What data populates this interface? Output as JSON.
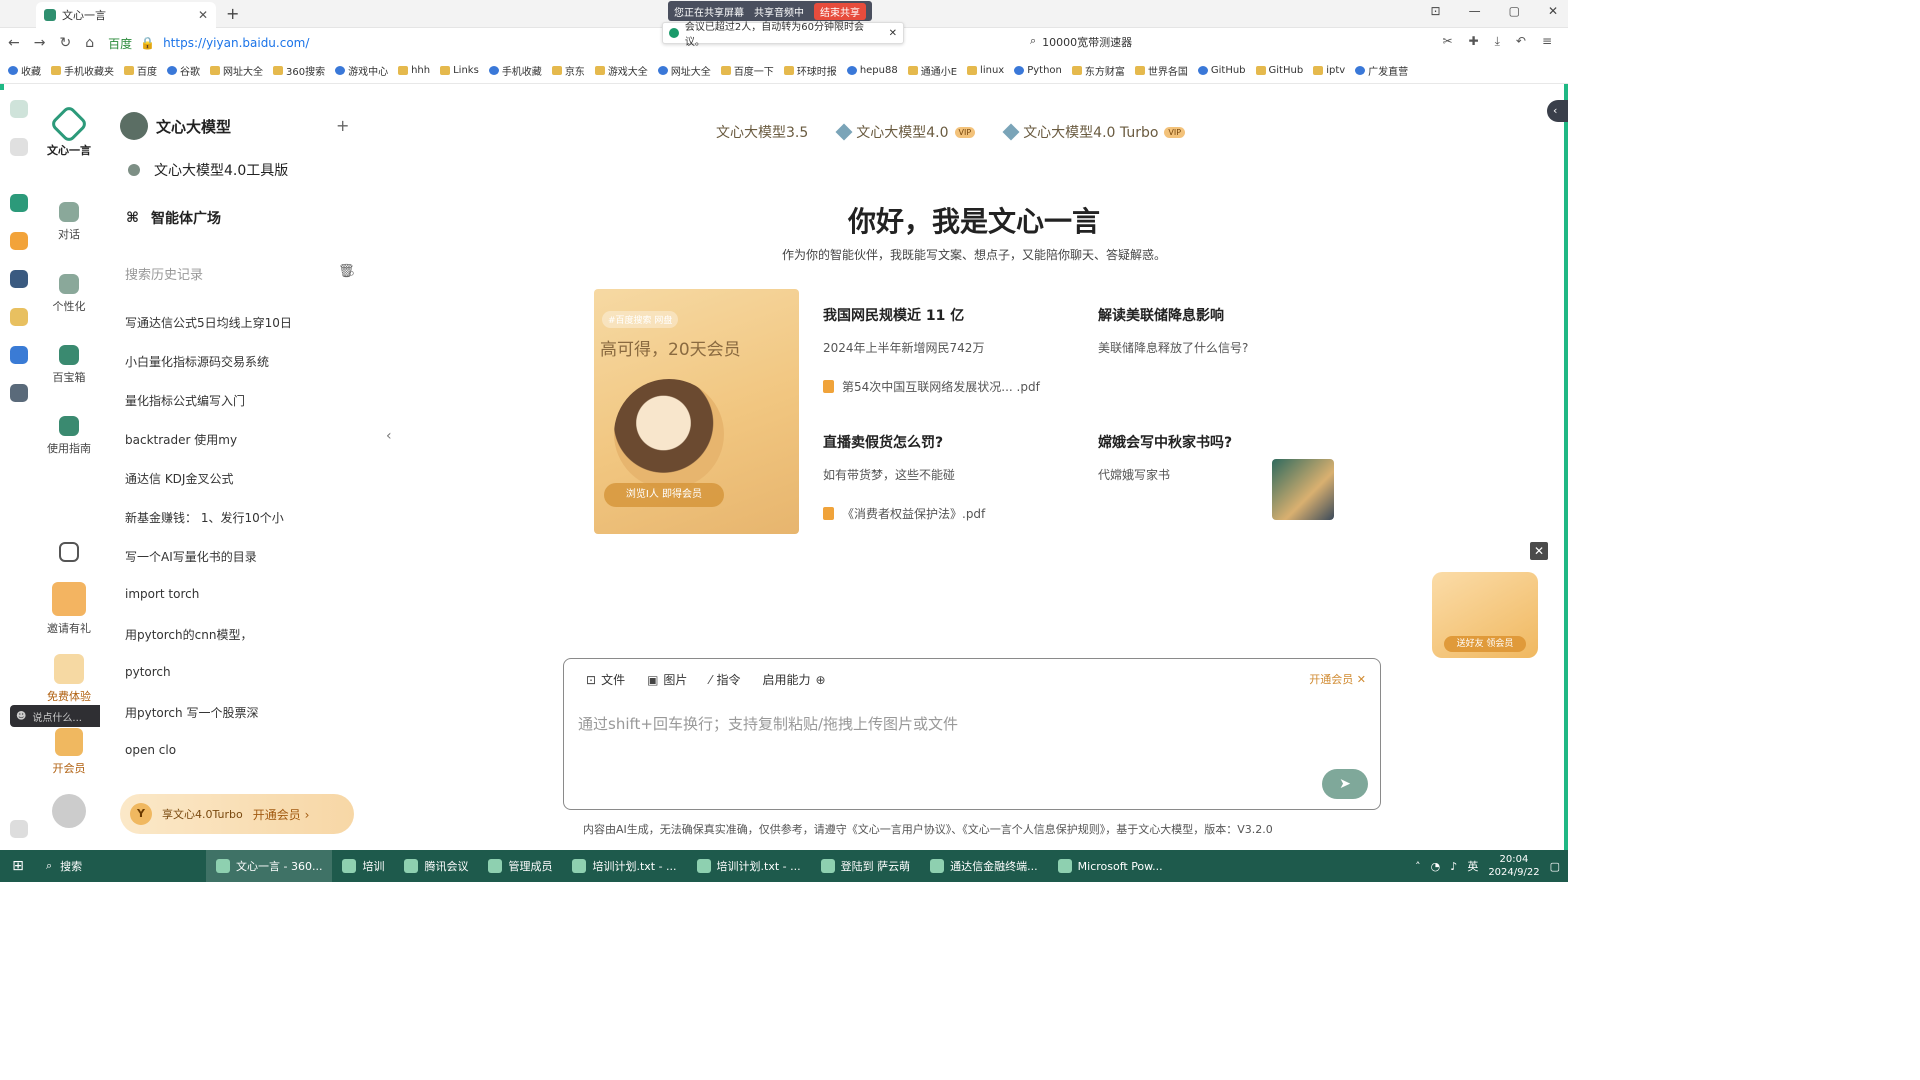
{
  "browser": {
    "tab_title": "文心一言",
    "url": "https://yiyan.baidu.com/",
    "url_site": "百度",
    "share_status": "您正在共享屏幕",
    "share_audio": "共享音频中",
    "end_share": "结束共享",
    "meeting_note": "会议已超过2人，自动转为60分钟限时会议。",
    "search_text": "10000宽带测速器"
  },
  "bookmarks": [
    "收藏",
    "手机收藏夹",
    "百度",
    "谷歌",
    "网址大全",
    "360搜索",
    "游戏中心",
    "hhh",
    "Links",
    "手机收藏",
    "京东",
    "游戏大全",
    "网址大全",
    "百度一下",
    "环球时报",
    "hepu88",
    "通通小E",
    "linux",
    "Python",
    "东方财富",
    "世界各国",
    "GitHub",
    "GitHub",
    "iptv",
    "广发直营"
  ],
  "nav": {
    "logo_label": "文心一言",
    "items": [
      {
        "label": "对话"
      },
      {
        "label": "个性化"
      },
      {
        "label": "百宝箱"
      },
      {
        "label": "使用指南"
      }
    ],
    "bottom": [
      {
        "label": "邀请有礼"
      },
      {
        "label": "免费体验"
      },
      {
        "label": "开会员"
      }
    ],
    "float_chip": "说点什么..."
  },
  "sidebar": {
    "title": "文心大模型",
    "tool_version": "文心大模型4.0工具版",
    "agent_plaza": "智能体广场",
    "search_placeholder": "搜索历史记录",
    "history": [
      "写通达信公式5日均线上穿10日",
      "小白量化指标源码交易系统",
      "量化指标公式编写入门",
      "backtrader 使用my",
      "通达信 KDJ金叉公式",
      "新基金赚钱： 1、发行10个小",
      "写一个AI写量化书的目录",
      "import torch",
      "用pytorch的cnn模型，",
      "pytorch",
      "用pytorch 写一个股票深",
      "open clo"
    ],
    "vip_text": "享文心4.0Turbo",
    "vip_open": "开通会员 ›"
  },
  "main": {
    "models": [
      {
        "label": "文心大模型3.5",
        "badge": ""
      },
      {
        "label": "文心大模型4.0",
        "badge": "VIP"
      },
      {
        "label": "文心大模型4.0 Turbo",
        "badge": "VIP"
      }
    ],
    "greeting": "你好，我是文心一言",
    "subtitle": "作为你的智能伙伴，我既能写文案、想点子，又能陪你聊天、答疑解惑。",
    "banner": {
      "tag": "#百度搜索 网盘",
      "title": "高可得，20天会员",
      "button": "浏览I人 即得会员"
    },
    "cards": [
      {
        "title": "我国网民规模近 11 亿",
        "subtitle": "2024年上半年新增网民742万",
        "file": "第54次中国互联网络发展状况... .pdf"
      },
      {
        "title": "解读美联储降息影响",
        "subtitle": "美联储降息释放了什么信号?",
        "file": ""
      },
      {
        "title": "直播卖假货怎么罚?",
        "subtitle": "如有带货梦，这些不能碰",
        "file": "《消费者权益保护法》.pdf"
      },
      {
        "title": "嫦娥会写中秋家书吗?",
        "subtitle": "代嫦娥写家书",
        "file": ""
      }
    ],
    "vip_float": "送好友 领会员"
  },
  "composer": {
    "tools": [
      {
        "label": "文件",
        "icon": "file-icon"
      },
      {
        "label": "图片",
        "icon": "image-icon"
      },
      {
        "label": "指令",
        "icon": "command-icon"
      },
      {
        "label": "启用能力",
        "icon": "globe-icon"
      }
    ],
    "member": "开通会员",
    "placeholder": "通过shift+回车换行；支持复制粘贴/拖拽上传图片或文件"
  },
  "footer": "内容由AI生成，无法确保真实准确，仅供参考，请遵守《文心一言用户协议》、《文心一言个人信息保护规则》，基于文心大模型，版本：V3.2.0",
  "taskbar": {
    "search": "搜索",
    "tasks": [
      "文心一言 - 360...",
      "培训",
      "腾讯会议",
      "管理成员",
      "培训计划.txt - ...",
      "培训计划.txt - ...",
      "登陆到 萨云萌",
      "通达信金融终端...",
      "Microsoft Pow..."
    ],
    "ime": "英",
    "time": "20:04",
    "date": "2024/9/22"
  }
}
